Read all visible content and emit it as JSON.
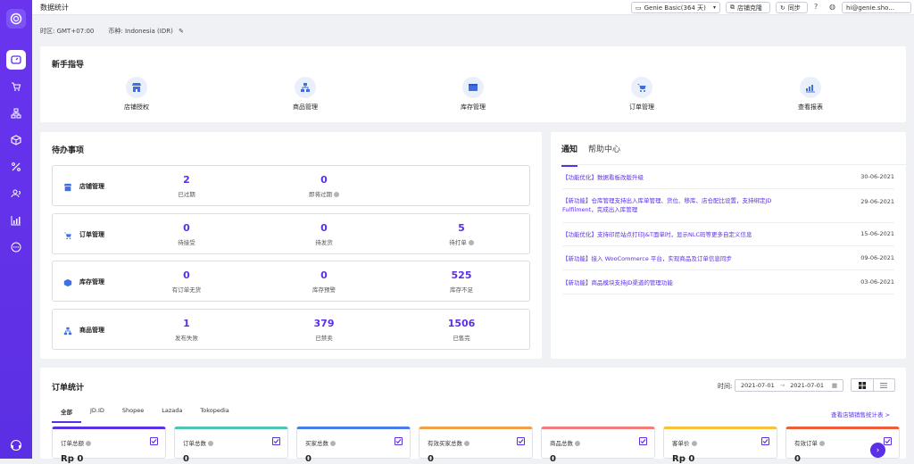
{
  "topbar": {
    "title": "数据统计",
    "plan": "Genie Basic(364 天)",
    "clone": "店铺克隆",
    "sync": "同步",
    "user": "hi@genie.sho..."
  },
  "timezone": {
    "tz": "时区: GMT+07:00",
    "currency": "币种: Indonesia (IDR)"
  },
  "guide": {
    "title": "新手指导",
    "items": [
      "店铺授权",
      "商品管理",
      "库存管理",
      "订单管理",
      "查看报表"
    ]
  },
  "todo": {
    "title": "待办事项",
    "rows": [
      {
        "name": "店铺管理",
        "stats": [
          {
            "num": "2",
            "label": "已过期"
          },
          {
            "num": "0",
            "label": "即将过期"
          }
        ]
      },
      {
        "name": "订单管理",
        "stats": [
          {
            "num": "0",
            "label": "待接受"
          },
          {
            "num": "0",
            "label": "待发货"
          },
          {
            "num": "5",
            "label": "待打单"
          }
        ]
      },
      {
        "name": "库存管理",
        "stats": [
          {
            "num": "0",
            "label": "有订单无货"
          },
          {
            "num": "0",
            "label": "库存预警"
          },
          {
            "num": "525",
            "label": "库存不足"
          }
        ]
      },
      {
        "name": "商品管理",
        "stats": [
          {
            "num": "1",
            "label": "发布失败"
          },
          {
            "num": "379",
            "label": "已禁卖"
          },
          {
            "num": "1506",
            "label": "已售完"
          }
        ]
      }
    ]
  },
  "notices": {
    "tabs": [
      "通知",
      "帮助中心"
    ],
    "items": [
      {
        "text": "【功能优化】数据看板改版升级",
        "date": "30-06-2021"
      },
      {
        "text": "【新功能】仓库管理支持出入库单管理、货位、移库、店仓配比设置，支持绑定JD Fulfilment，完成出入库管理",
        "date": "29-06-2021"
      },
      {
        "text": "【功能优化】支持印尼站点打印J&T面单时，显示NLC码等更多自定义信息",
        "date": "15-06-2021"
      },
      {
        "text": "【新功能】接入 WooCommerce 平台，实现商品及订单信息同步",
        "date": "09-06-2021"
      },
      {
        "text": "【新功能】商品模块支持JD渠道的管理功能",
        "date": "03-06-2021"
      }
    ]
  },
  "orders": {
    "title": "订单统计",
    "time_label": "时间:",
    "date_from": "2021-07-01",
    "date_arrow": "→",
    "date_to": "2021-07-01",
    "tabs": [
      "全部",
      "JD.ID",
      "Shopee",
      "Lazada",
      "Tokopedia"
    ],
    "link": "查看店铺销售统计表 >",
    "cards": [
      {
        "label": "订单总额",
        "value": "Rp 0",
        "color": "#5b2fe3"
      },
      {
        "label": "订单总数",
        "value": "0",
        "color": "#4fc3b4"
      },
      {
        "label": "买家总数",
        "value": "0",
        "color": "#4a7be8"
      },
      {
        "label": "有效买家总数",
        "value": "0",
        "color": "#f0a04b"
      },
      {
        "label": "商品总数",
        "value": "0",
        "color": "#f27d7d"
      },
      {
        "label": "客单价",
        "value": "Rp 0",
        "color": "#f5c23d"
      },
      {
        "label": "有效订单",
        "value": "0",
        "color": "#ef5e3a"
      }
    ]
  }
}
